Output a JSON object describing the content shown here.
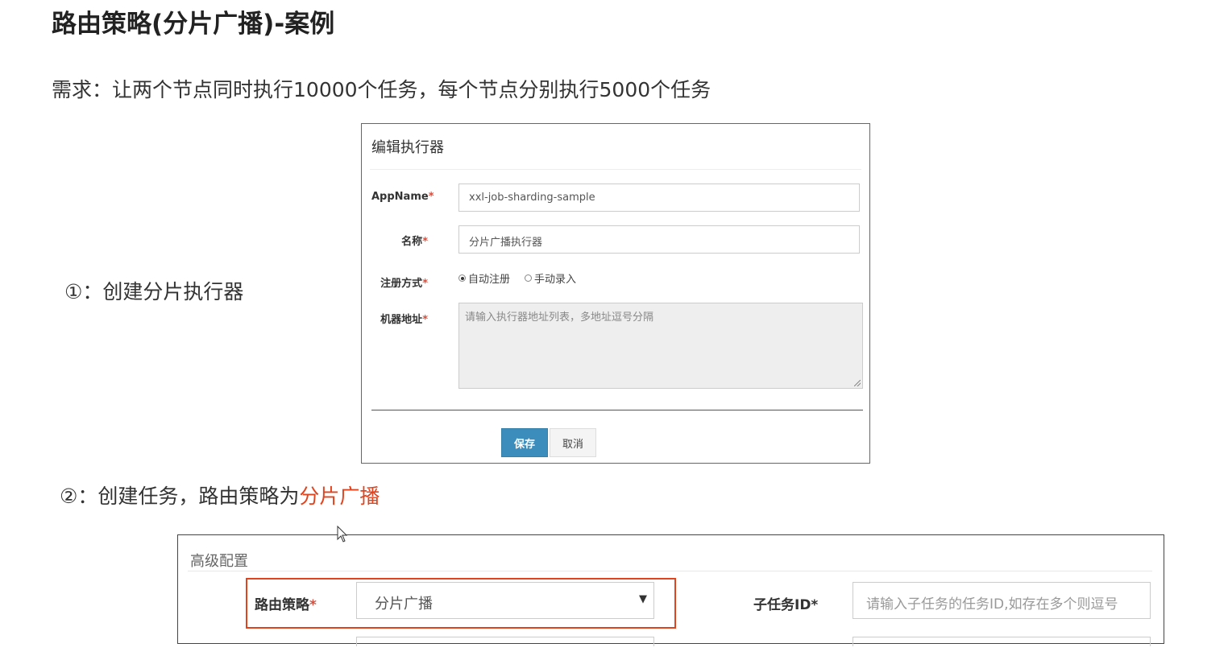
{
  "title": "路由策略(分片广播)-案例",
  "requirement": "需求：让两个节点同时执行10000个任务，每个节点分别执行5000个任务",
  "step1": "①：创建分片执行器",
  "step2": {
    "prefix": "②：创建任务，路由策略为",
    "highlight": "分片广播",
    "highlight_color": "#e0441f"
  },
  "dialog": {
    "title": "编辑执行器",
    "fields": [
      {
        "label": "AppName",
        "value": "xxl-job-sharding-sample"
      },
      {
        "label": "名称",
        "value": "分片广播执行器"
      },
      {
        "label": "注册方式"
      },
      {
        "label": "机器地址",
        "placeholder": "请输入执行器地址列表，多地址逗号分隔"
      }
    ],
    "radio_options": [
      {
        "label": "自动注册",
        "checked": true
      },
      {
        "label": "手动录入",
        "checked": false
      }
    ],
    "required_mark": "*",
    "save_label": "保存",
    "cancel_label": "取消",
    "primary_color": "#3c8dbc"
  },
  "advanced": {
    "title": "高级配置",
    "route_label": "路由策略",
    "route_value": "分片广播",
    "subtask_label": "子任务ID*",
    "subtask_placeholder": "请输入子任务的任务ID,如存在多个则逗号"
  }
}
